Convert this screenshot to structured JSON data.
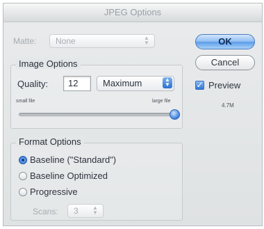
{
  "dialog": {
    "title": "JPEG Options"
  },
  "matte": {
    "label": "Matte:",
    "value": "None"
  },
  "image_options": {
    "title": "Image Options",
    "quality_label": "Quality:",
    "quality_value": "12",
    "preset_value": "Maximum",
    "small_label": "small file",
    "large_label": "large file",
    "slider_level_fraction": 1.0
  },
  "format_options": {
    "title": "Format Options",
    "options": [
      {
        "label": "Baseline (\"Standard\")",
        "selected": true
      },
      {
        "label": "Baseline Optimized",
        "selected": false
      },
      {
        "label": "Progressive",
        "selected": false
      }
    ],
    "scans_label": "Scans:",
    "scans_value": "3"
  },
  "buttons": {
    "ok_label": "OK",
    "cancel_label": "Cancel"
  },
  "preview": {
    "label": "Preview",
    "checked": true,
    "size_text": "4.7M"
  },
  "icons": {
    "popup_arrows": "up-down-arrows-icon",
    "checkmark": "checkmark-icon"
  },
  "colors": {
    "accent_blue": "#2f74d6",
    "default_button": "#8cbcf2"
  }
}
